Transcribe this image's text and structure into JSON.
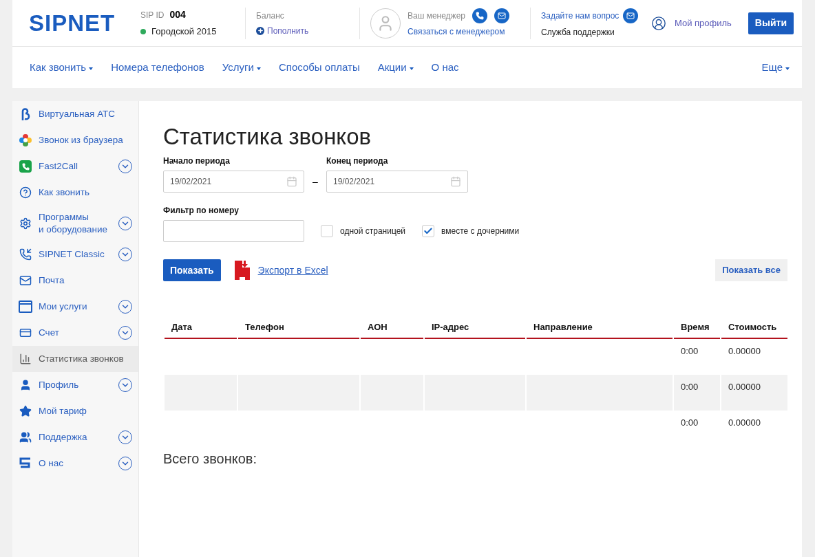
{
  "header": {
    "logo": "SIPNET",
    "sip_id_label": "SIP ID",
    "sip_id": "004",
    "tariff": "Городской 2015",
    "online": true,
    "balance_label": "Баланс",
    "topup": "Пополнить",
    "manager_label": "Ваш менеджер",
    "manager_link": "Связаться с менеджером",
    "ask_link": "Задайте нам вопрос",
    "support": "Служба поддержки",
    "profile": "Мой профиль",
    "logout": "Выйти"
  },
  "nav": [
    {
      "label": "Как звонить",
      "dropdown": true
    },
    {
      "label": "Номера телефонов",
      "dropdown": false
    },
    {
      "label": "Услуги",
      "dropdown": true
    },
    {
      "label": "Способы оплаты",
      "dropdown": false
    },
    {
      "label": "Акции",
      "dropdown": true
    },
    {
      "label": "О нас",
      "dropdown": false
    }
  ],
  "nav_more": {
    "label": "Еще",
    "dropdown": true
  },
  "sidebar": [
    {
      "kind": "vats",
      "label": "Виртуальная АТС",
      "expandable": false,
      "selected": false
    },
    {
      "kind": "browser",
      "label": "Звонок из браузера",
      "expandable": false,
      "selected": false
    },
    {
      "kind": "fast2call",
      "label": "Fast2Call",
      "expandable": true,
      "selected": false
    },
    {
      "kind": "howto",
      "label": "Как звонить",
      "expandable": false,
      "selected": false
    },
    {
      "kind": "gear",
      "label": "Программы\nи оборудование",
      "expandable": true,
      "selected": false
    },
    {
      "kind": "classic",
      "label": "SIPNET Classic",
      "expandable": true,
      "selected": false
    },
    {
      "kind": "mail",
      "label": "Почта",
      "expandable": false,
      "selected": false
    },
    {
      "kind": "services",
      "label": "Мои услуги",
      "expandable": true,
      "selected": false
    },
    {
      "kind": "card",
      "label": "Счет",
      "expandable": true,
      "selected": false
    },
    {
      "kind": "stats",
      "label": "Статистика звонков",
      "expandable": false,
      "selected": true
    },
    {
      "kind": "user",
      "label": "Профиль",
      "expandable": true,
      "selected": false
    },
    {
      "kind": "star",
      "label": "Мой тариф",
      "expandable": false,
      "selected": false
    },
    {
      "kind": "users",
      "label": "Поддержка",
      "expandable": true,
      "selected": false
    },
    {
      "kind": "s",
      "label": "О нас",
      "expandable": true,
      "selected": false
    }
  ],
  "page": {
    "title": "Статистика звонков",
    "start_label": "Начало периода",
    "start_value": "19/02/2021",
    "dash": "–",
    "end_label": "Конец периода",
    "end_value": "19/02/2021",
    "filter_label": "Фильтр по номеру",
    "checkboxes": [
      {
        "label": "одной страницей",
        "checked": false
      },
      {
        "label": "вместе с дочерними",
        "checked": true
      }
    ],
    "show_button": "Показать",
    "export_link": "Экспорт в Excel",
    "show_all_button": "Показать все",
    "total_label": "Всего звонков:"
  },
  "table": {
    "columns": [
      "Дата",
      "Телефон",
      "АОН",
      "IP-адрес",
      "Направление",
      "Время",
      "Стоимость"
    ],
    "rows": [
      {
        "time": "0:00",
        "cost": "0.00000"
      },
      {
        "time": "0:00",
        "cost": "0.00000"
      },
      {
        "time": "0:00",
        "cost": "0.00000"
      }
    ]
  }
}
